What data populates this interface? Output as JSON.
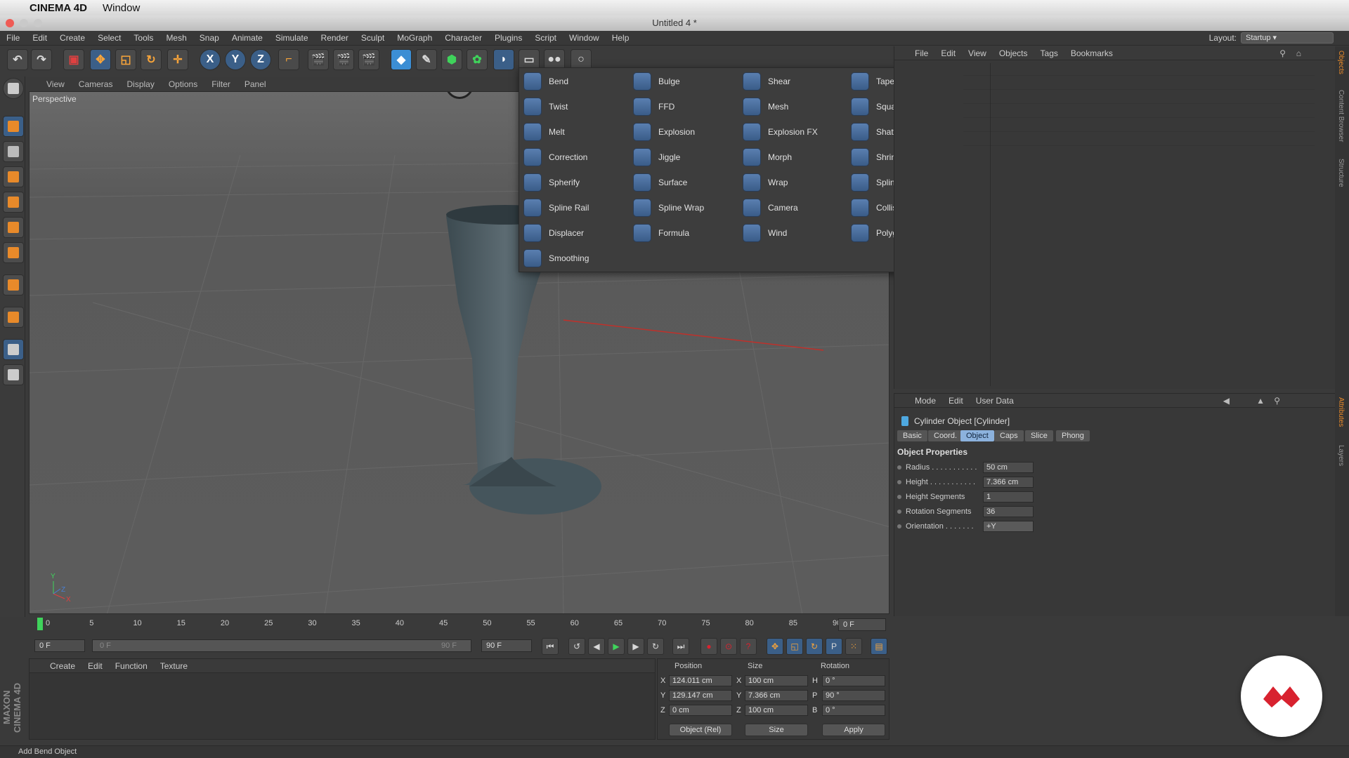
{
  "mac_menu": {
    "app_name": "CINEMA 4D",
    "window_menu": "Window"
  },
  "window": {
    "title": "Untitled 4 *"
  },
  "main_menu": [
    "File",
    "Edit",
    "Create",
    "Select",
    "Tools",
    "Mesh",
    "Snap",
    "Animate",
    "Simulate",
    "Render",
    "Sculpt",
    "MoGraph",
    "Character",
    "Plugins",
    "Script",
    "Window",
    "Help"
  ],
  "layout": {
    "label": "Layout:",
    "value": "Startup"
  },
  "toolbar": {
    "x": "X",
    "y": "Y",
    "z": "Z"
  },
  "viewport": {
    "menu": [
      "View",
      "Cameras",
      "Display",
      "Options",
      "Filter",
      "Panel"
    ],
    "label": "Perspective"
  },
  "deformer_menu": {
    "items": [
      [
        "Bend",
        "Bulge",
        "Shear",
        "Taper"
      ],
      [
        "Twist",
        "FFD",
        "Mesh",
        "Squash & Stretch"
      ],
      [
        "Melt",
        "Explosion",
        "Explosion FX",
        "Shatter"
      ],
      [
        "Correction",
        "Jiggle",
        "Morph",
        "Shrink Wrap"
      ],
      [
        "Spherify",
        "Surface",
        "Wrap",
        "Spline"
      ],
      [
        "Spline Rail",
        "Spline Wrap",
        "Camera",
        "Collision"
      ],
      [
        "Displacer",
        "Formula",
        "Wind",
        "Polygon Reduction"
      ],
      [
        "Smoothing"
      ]
    ]
  },
  "object_manager": {
    "menu": [
      "File",
      "Edit",
      "View",
      "Objects",
      "Tags",
      "Bookmarks"
    ]
  },
  "side_tabs": {
    "top": [
      "Objects",
      "Content Browser",
      "Structure"
    ],
    "bottom": [
      "Attributes",
      "Layers"
    ]
  },
  "attributes": {
    "menu": [
      "Mode",
      "Edit",
      "User Data"
    ],
    "object_name": "Cylinder Object [Cylinder]",
    "tabs": [
      "Basic",
      "Coord.",
      "Object",
      "Caps",
      "Slice",
      "Phong"
    ],
    "active_tab": "Object",
    "section": "Object Properties",
    "props": [
      {
        "label": "Radius . . . . . . . . . . .",
        "value": "50 cm"
      },
      {
        "label": "Height . . . . . . . . . . .",
        "value": "7.366 cm"
      },
      {
        "label": "Height Segments",
        "value": "1"
      },
      {
        "label": "Rotation Segments",
        "value": "36"
      },
      {
        "label": "Orientation . . . . . . .",
        "value": "+Y"
      }
    ]
  },
  "timeline": {
    "ticks": [
      "0",
      "5",
      "10",
      "15",
      "20",
      "25",
      "30",
      "35",
      "40",
      "45",
      "50",
      "55",
      "60",
      "65",
      "70",
      "75",
      "80",
      "85",
      "90"
    ],
    "current_frame": "0 F",
    "start": "0 F",
    "range_start": "0 F",
    "range_end": "90 F",
    "end": "90 F"
  },
  "material_manager": {
    "menu": [
      "Create",
      "Edit",
      "Function",
      "Texture"
    ]
  },
  "coordinates": {
    "headers": [
      "Position",
      "Size",
      "Rotation"
    ],
    "rows": [
      {
        "axis": "X",
        "pos": "124.011 cm",
        "size_axis": "X",
        "size": "100 cm",
        "rot_axis": "H",
        "rot": "0 °"
      },
      {
        "axis": "Y",
        "pos": "129.147 cm",
        "size_axis": "Y",
        "size": "7.366 cm",
        "rot_axis": "P",
        "rot": "90 °"
      },
      {
        "axis": "Z",
        "pos": "0 cm",
        "size_axis": "Z",
        "size": "100 cm",
        "rot_axis": "B",
        "rot": "0 °"
      }
    ],
    "mode": "Object (Rel)",
    "size_mode": "Size",
    "apply": "Apply"
  },
  "status": "Add Bend Object",
  "branding": "MAXON CINEMA 4D",
  "colors": {
    "accent_blue": "#8cb2dd",
    "object_orange": "#e88a2a",
    "play_green": "#2fcf4a",
    "record_red": "#d8222f"
  }
}
